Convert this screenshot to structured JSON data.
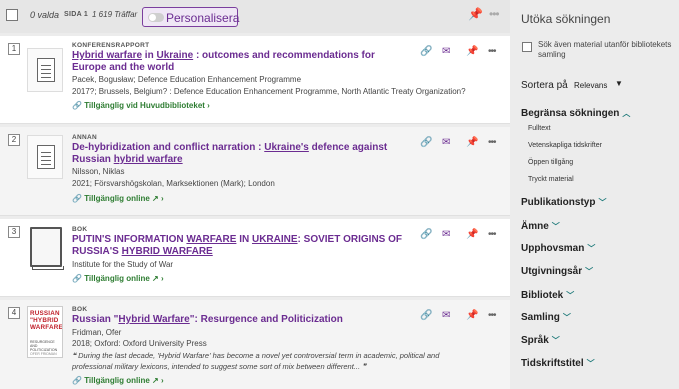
{
  "toolbar": {
    "selected": "0 valda",
    "page": "SIDA 1",
    "hits": "1 619 Träffar",
    "personalize_label": "Personalisera"
  },
  "results": [
    {
      "num": "1",
      "type": "KONFERENSRAPPORT",
      "title_parts": [
        "Hybrid warfare",
        " in ",
        "Ukraine",
        " : outcomes and recommendations for Europe and the world"
      ],
      "meta1": "Pacek, Bogusław; Defence Education Enhancement Programme",
      "meta2": "2017?; Brussels, Belgium? : Defence Education Enhancement Programme, North Atlantic Treaty Organization?",
      "availability": "Tillgänglig vid Huvudbiblioteket"
    },
    {
      "num": "2",
      "type": "ANNAN",
      "title_parts": [
        "De-hybridization and conflict narration : ",
        "Ukraine's",
        " defence against Russian ",
        "hybrid warfare"
      ],
      "meta1": "Nilsson, Niklas",
      "meta2": "2021; Försvarshögskolan, Marksektionen (Mark); London",
      "availability": "Tillgänglig online"
    },
    {
      "num": "3",
      "type": "BOK",
      "title_parts": [
        "PUTIN'S INFORMATION ",
        "WARFARE",
        " IN ",
        "UKRAINE",
        ": SOVIET ORIGINS OF RUSSIA'S ",
        "HYBRID WARFARE"
      ],
      "meta1": "Institute for the Study of War",
      "availability": "Tillgänglig online"
    },
    {
      "num": "4",
      "type": "BOK",
      "title_parts": [
        "Russian \"",
        "Hybrid Warfare",
        "\": Resurgence and Politicization"
      ],
      "meta1": "Fridman, Ofer",
      "meta2": "2018; Oxford: Oxford University Press",
      "quote": "During the last decade, 'Hybrid Warfare' has become a novel yet controversial term in academic, political and professional military lexicons, intended to suggest some sort of mix between different...",
      "availability": "Tillgänglig online",
      "cover_title": "RUSSIAN \"HYBRID WARFARE\"",
      "cover_sub": "RESURGENCE AND POLITICIZATION",
      "cover_author": "OFER FRIDMAN"
    }
  ],
  "sidebar": {
    "heading": "Utöka sökningen",
    "expand_label": "Sök även material utanför bibliotekets samling",
    "sort_label": "Sortera på",
    "sort_value": "Relevans",
    "limit_heading": "Begränsa sökningen",
    "limit_options": [
      "Fulltext",
      "Vetenskapliga tidskrifter",
      "Öppen tillgång",
      "Tryckt material"
    ],
    "facets": [
      "Publikationstyp",
      "Ämne",
      "Upphovsman",
      "Utgivningsår",
      "Bibliotek",
      "Samling",
      "Språk",
      "Tidskriftstitel"
    ]
  },
  "colors": {
    "accent": "#6b2c91",
    "available": "#2e7d32",
    "facet_chevron": "#1f7a7a"
  }
}
